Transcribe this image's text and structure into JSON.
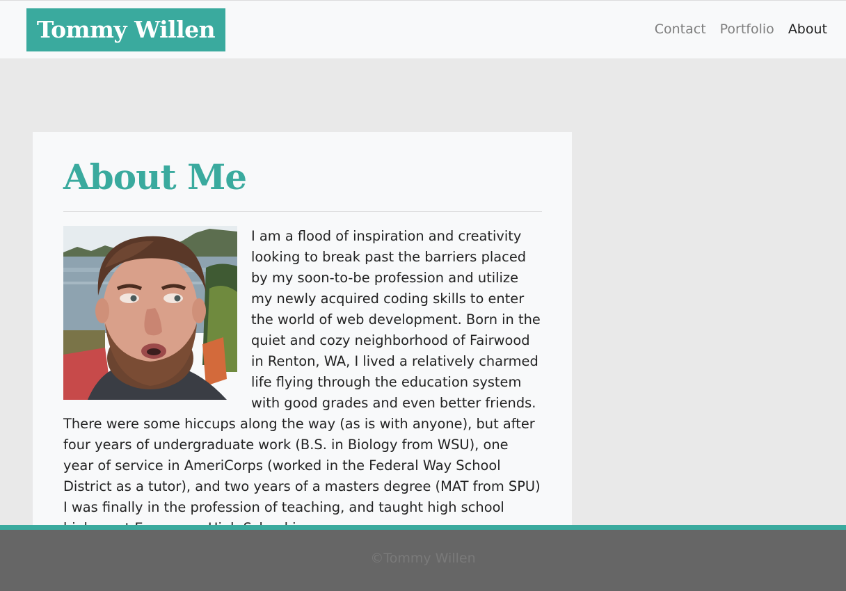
{
  "navbar": {
    "brand": "Tommy Willen",
    "links": [
      {
        "label": "Contact",
        "active": false
      },
      {
        "label": "Portfolio",
        "active": false
      },
      {
        "label": "About",
        "active": true
      }
    ]
  },
  "main": {
    "heading": "About Me",
    "photo_alt": "photo of Tommy Willen",
    "bio": "I am a flood of inspiration and creativity looking to break past the barriers placed by my soon-to-be profession and utilize my newly acquired coding skills to enter the world of web development. Born in the quiet and cozy neighborhood of Fairwood in Renton, WA, I lived a relatively charmed life flying through the education system with good grades and even better friends. There were some hiccups along the way (as is with anyone), but after four years of undergraduate work (B.S. in Biology from WSU), one year of service in AmeriCorps (worked in the Federal Way School District as a tutor), and two years of a masters degree (MAT from SPU) I was finally in the profession of teaching, and taught high school biology at Evergreen High School in"
  },
  "footer": {
    "text": "©Tommy Willen"
  },
  "colors": {
    "accent": "#3aaa9e",
    "footer_bg": "#666666",
    "page_bg": "#e9e9e9"
  }
}
